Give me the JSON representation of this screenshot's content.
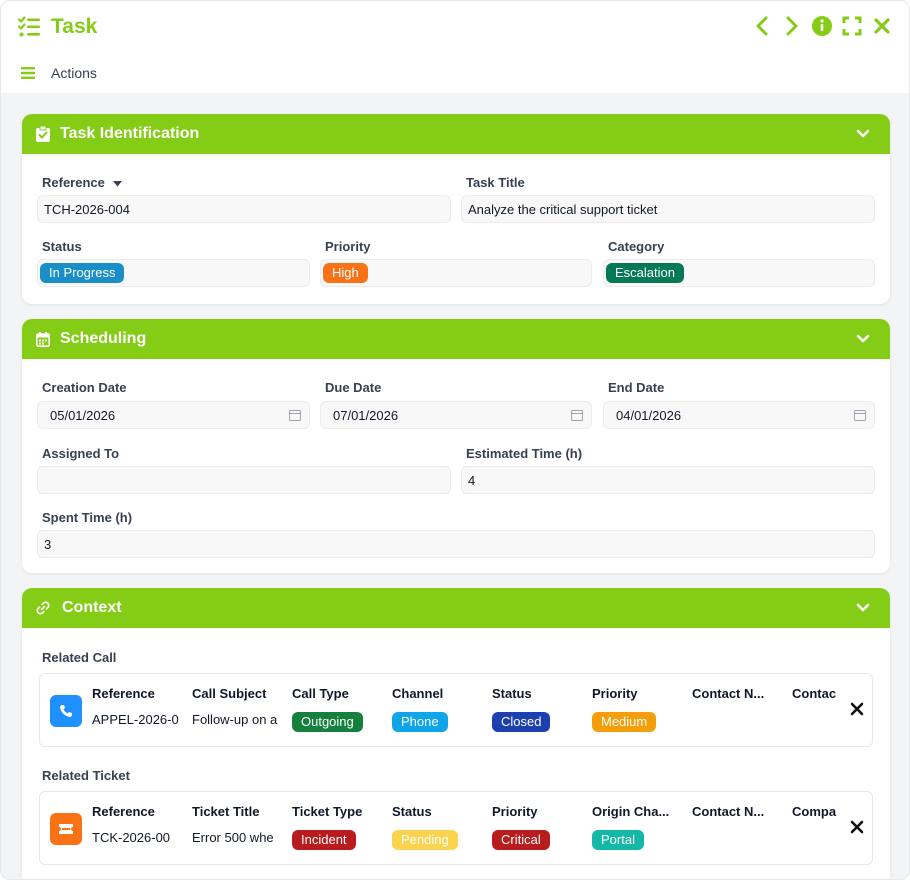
{
  "window": {
    "title": "Task",
    "actions_label": "Actions"
  },
  "colors": {
    "accent": "#84cc16",
    "status_in_progress": "#1a8fc7",
    "priority_high": "#f97316",
    "category_escalation": "#047857"
  },
  "identification": {
    "title": "Task Identification",
    "reference_label": "Reference",
    "reference_value": "TCH-2026-004",
    "task_title_label": "Task Title",
    "task_title_value": "Analyze the critical support ticket",
    "status_label": "Status",
    "status_value": "In Progress",
    "priority_label": "Priority",
    "priority_value": "High",
    "category_label": "Category",
    "category_value": "Escalation"
  },
  "scheduling": {
    "title": "Scheduling",
    "creation_date_label": "Creation Date",
    "creation_date_value": "05/01/2026",
    "due_date_label": "Due Date",
    "due_date_value": "07/01/2026",
    "end_date_label": "End Date",
    "end_date_value": "04/01/2026",
    "assigned_to_label": "Assigned To",
    "assigned_to_value": "",
    "estimated_time_label": "Estimated Time (h)",
    "estimated_time_value": "4",
    "spent_time_label": "Spent Time (h)",
    "spent_time_value": "3"
  },
  "context": {
    "title": "Context",
    "related_call": {
      "label": "Related Call",
      "columns": [
        {
          "header": "Reference",
          "value": "APPEL-2026-0",
          "badge": false
        },
        {
          "header": "Call Subject",
          "value": "Follow-up on a",
          "badge": false
        },
        {
          "header": "Call Type",
          "value": "Outgoing",
          "badge": true,
          "color": "#15803d"
        },
        {
          "header": "Channel",
          "value": "Phone",
          "badge": true,
          "color": "#0ea5e9"
        },
        {
          "header": "Status",
          "value": "Closed",
          "badge": true,
          "color": "#1e40af"
        },
        {
          "header": "Priority",
          "value": "Medium",
          "badge": true,
          "color": "#f59e0b"
        },
        {
          "header": "Contact N...",
          "value": "",
          "badge": false
        },
        {
          "header": "Contac",
          "value": "",
          "badge": false
        }
      ]
    },
    "related_ticket": {
      "label": "Related Ticket",
      "columns": [
        {
          "header": "Reference",
          "value": "TCK-2026-00",
          "badge": false
        },
        {
          "header": "Ticket Title",
          "value": "Error 500 whe",
          "badge": false
        },
        {
          "header": "Ticket Type",
          "value": "Incident",
          "badge": true,
          "color": "#b91c1c"
        },
        {
          "header": "Status",
          "value": "Pending",
          "badge": true,
          "color": "#fcd34d"
        },
        {
          "header": "Priority",
          "value": "Critical",
          "badge": true,
          "color": "#b91c1c"
        },
        {
          "header": "Origin Cha...",
          "value": "Portal",
          "badge": true,
          "color": "#14b8a6"
        },
        {
          "header": "Contact N...",
          "value": "",
          "badge": false
        },
        {
          "header": "Compa",
          "value": "",
          "badge": false
        }
      ]
    }
  }
}
